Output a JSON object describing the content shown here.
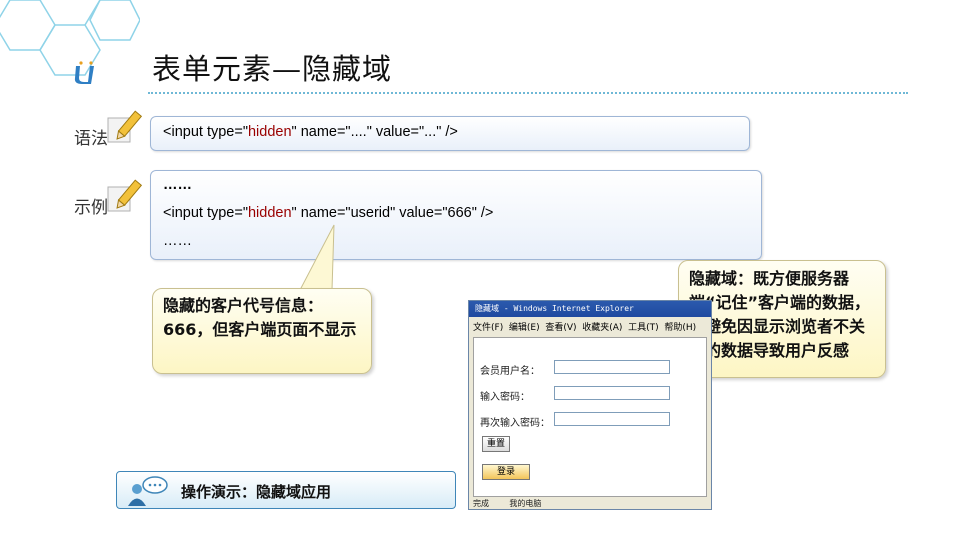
{
  "slide": {
    "title": "表单元素—隐藏域"
  },
  "syntax": {
    "label": "语法",
    "code": {
      "p1": "<input type=\"",
      "p2": "hidden",
      "p3": "\" name=\"....\" value=\"...\" />"
    }
  },
  "example": {
    "label": "示例",
    "line1": "……",
    "code": {
      "p1": "<input type=\"",
      "p2": "hidden",
      "p3": "\" name=\"userid\" value=\"666\" />"
    },
    "line3": "……"
  },
  "callouts": {
    "left": "隐藏的客户代号信息：666，但客户端页面不显示",
    "right": "隐藏域：既方便服务器端“记住”客户端的数据，又避免因显示浏览者不关心的数据导致用户反感"
  },
  "demo": {
    "label": "操作演示：隐藏域应用"
  },
  "browser": {
    "title": "隐藏域 - Windows Internet Explorer",
    "menu": "文件(F)  编辑(E)  查看(V)  收藏夹(A)  工具(T)  帮助(H)",
    "fields": [
      {
        "label": "会员用户名："
      },
      {
        "label": "输入密码："
      },
      {
        "label": "再次输入密码："
      }
    ],
    "reset_label": "重置",
    "submit_label": "登录",
    "status": "完成        我的电脑"
  },
  "colors": {
    "accent": "#6fb8d6",
    "keyword": "#0000cc",
    "value": "#990000"
  }
}
